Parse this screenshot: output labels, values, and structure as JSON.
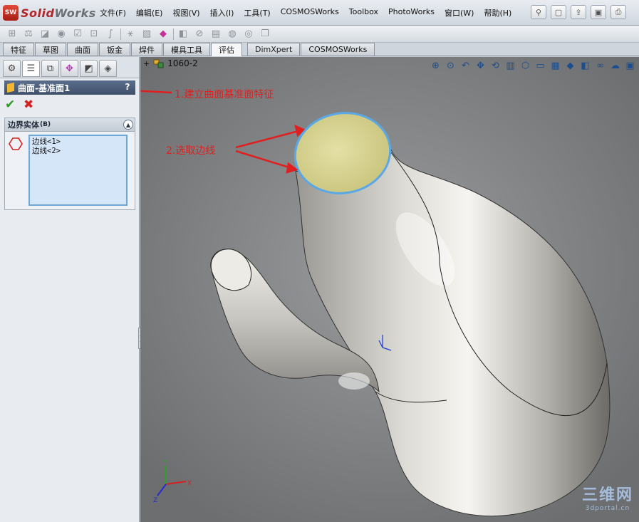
{
  "app": {
    "logo_badge": "SW",
    "logo_solid": "Solid",
    "logo_works": "Works"
  },
  "menu": [
    "文件(F)",
    "编辑(E)",
    "视图(V)",
    "插入(I)",
    "工具(T)",
    "COSMOSWorks",
    "Toolbox",
    "PhotoWorks",
    "窗口(W)",
    "帮助(H)"
  ],
  "tabs": [
    {
      "label": "特征",
      "active": false
    },
    {
      "label": "草图",
      "active": false
    },
    {
      "label": "曲面",
      "active": false
    },
    {
      "label": "钣金",
      "active": false
    },
    {
      "label": "焊件",
      "active": false
    },
    {
      "label": "模具工具",
      "active": false
    },
    {
      "label": "评估",
      "active": true
    },
    {
      "label": "DimXpert",
      "active": false,
      "ext": true
    },
    {
      "label": "COSMOSWorks",
      "active": false,
      "ext": true
    }
  ],
  "feature": {
    "title": "曲面-基准面1",
    "help": "?",
    "ok": "✔",
    "cancel": "✖"
  },
  "boundary_group": {
    "title": "边界实体",
    "title_suffix": "(B)",
    "items": [
      "边线<1>",
      "边线<2>"
    ]
  },
  "document": {
    "name": "1060-2"
  },
  "annotations": {
    "step1": "1.建立曲面基准面特征",
    "step2": "2.选取边线"
  },
  "watermark": {
    "line1": "三维网",
    "line2": "3dportal.cn"
  },
  "colors": {
    "annotation": "#e02020",
    "selected_edge": "#5aa8e6",
    "face_fill": "#d8d48e",
    "model": "#cfcdc6"
  }
}
